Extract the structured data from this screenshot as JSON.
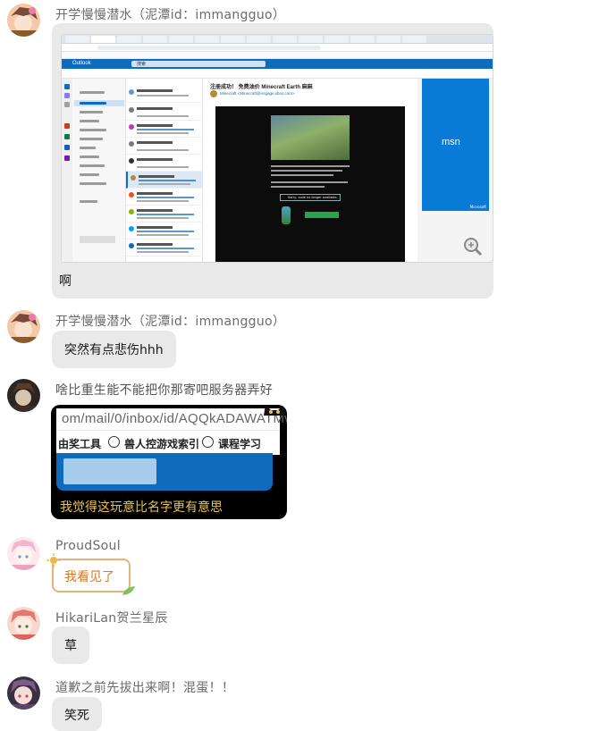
{
  "messages": [
    {
      "sender": "开学慢慢潜水（泥潭id：immangguo）",
      "screenshot": {
        "app_name": "Outlook",
        "search_label": "搜索",
        "email_subject": "注册成功！ 免费油价 Minecraft Earth 麻麻",
        "email_from": "Minecraft <Minecraft@engage.xbox.com>",
        "mail_box_text": "Sorry, code no longer available.",
        "ad_brand": "msn",
        "ad_footer": "Microsoft"
      },
      "text": "啊"
    },
    {
      "sender": "开学慢慢潜水（泥潭id：immangguo）",
      "text": "突然有点悲伤hhh"
    },
    {
      "sender": "啥比重生能不能把你那寄吧服务器弄好",
      "reply_shot": {
        "url": "om/mail/0/inbox/id/AQQkADAWATMw",
        "bookmarks": [
          "由奖工具",
          "兽人控游戏索引",
          "课程学习"
        ],
        "caption": "我觉得这玩意比名字更有意思"
      }
    },
    {
      "sender": "ProudSoul",
      "text": "我看见了"
    },
    {
      "sender": "HikariLan贺兰星辰",
      "text": "草"
    },
    {
      "sender": "道歉之前先拔出来啊！混蛋！！",
      "text": "笑死"
    }
  ],
  "colors": {
    "outlook_blue": "#0f6cbd",
    "bubble": "#e9e9e9",
    "caption_gold": "#e8c34d",
    "fancy_border": "#e9b27a"
  }
}
